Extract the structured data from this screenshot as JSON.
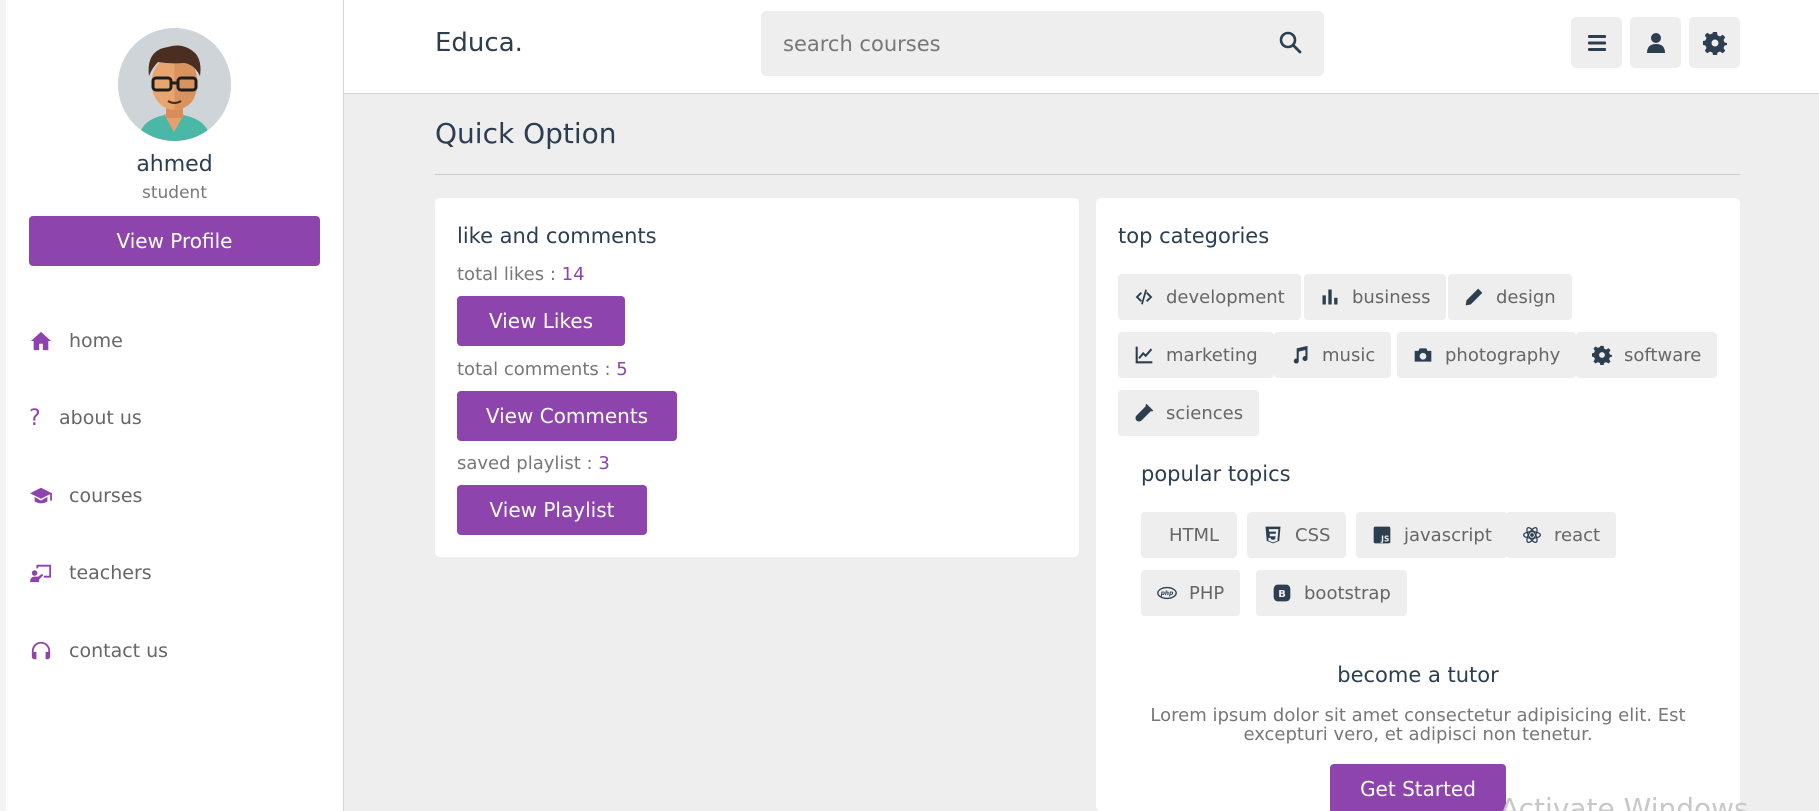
{
  "profile": {
    "name": "ahmed",
    "role": "student",
    "button_label": "View Profile"
  },
  "nav": {
    "items": [
      {
        "label": "home",
        "icon": "home-icon"
      },
      {
        "label": "about us",
        "icon": "question-icon"
      },
      {
        "label": "courses",
        "icon": "graduation-cap-icon"
      },
      {
        "label": "teachers",
        "icon": "chalkboard-teacher-icon"
      },
      {
        "label": "contact us",
        "icon": "headset-icon"
      }
    ]
  },
  "header": {
    "logo": "Educa.",
    "search_placeholder": "search courses",
    "buttons": [
      "menu-icon",
      "user-icon",
      "gear-icon"
    ]
  },
  "main": {
    "title": "Quick Option",
    "likes_card": {
      "title": "like and comments",
      "likes_label": "total likes : ",
      "likes_value": "14",
      "likes_button": "View Likes",
      "comments_label": "total comments : ",
      "comments_value": "5",
      "comments_button": "View Comments",
      "playlist_label": "saved playlist : ",
      "playlist_value": "3",
      "playlist_button": "View Playlist"
    },
    "categories_card": {
      "title": "top categories",
      "categories": [
        "development",
        "business",
        "design",
        "marketing",
        "music",
        "photography",
        "software",
        "sciences"
      ],
      "topics_title": "popular topics",
      "topics": [
        "HTML",
        "CSS",
        "javascript",
        "react",
        "PHP",
        "bootstrap"
      ],
      "tutor_title": "become a tutor",
      "tutor_text": "Lorem ipsum dolor sit amet consectetur adipisicing elit. Est excepturi vero, et adipisci non tenetur.",
      "tutor_button": "Get Started"
    }
  },
  "watermark": "Activate Windows",
  "colors": {
    "accent": "#8e44ad",
    "text": "#2c3e50",
    "muted": "#777777",
    "background": "#eeeeee"
  }
}
